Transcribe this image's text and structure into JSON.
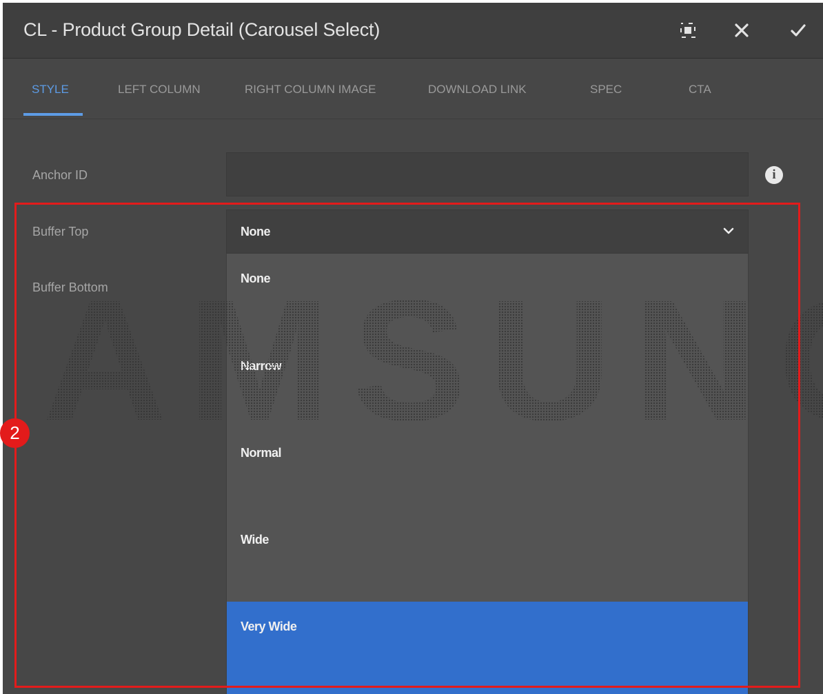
{
  "dialog": {
    "title": "CL - Product Group Detail (Carousel Select)",
    "buttons": {
      "fullscreen": "fullscreen-icon",
      "close": "close-icon",
      "done": "checkmark-icon"
    }
  },
  "tabs": [
    {
      "label": "STYLE",
      "active": true
    },
    {
      "label": "LEFT COLUMN",
      "active": false
    },
    {
      "label": "RIGHT COLUMN IMAGE",
      "active": false
    },
    {
      "label": "DOWNLOAD LINK",
      "active": false
    },
    {
      "label": "SPEC",
      "active": false
    },
    {
      "label": "CTA",
      "active": false
    }
  ],
  "form": {
    "anchor_id": {
      "label": "Anchor ID",
      "value": ""
    },
    "buffer_top": {
      "label": "Buffer Top",
      "value": "None"
    },
    "buffer_bottom": {
      "label": "Buffer Bottom"
    }
  },
  "dropdown": {
    "options": [
      "None",
      "Narrow",
      "Normal",
      "Wide",
      "Very Wide"
    ],
    "highlighted": "Very Wide"
  },
  "watermark": {
    "text": "SAMSUNG",
    "id": "09544469"
  },
  "annotation": {
    "number": "2"
  },
  "colors": {
    "accent": "#5d9ce6",
    "selected": "#326fcc",
    "highlight": "#e31b1b",
    "background": "#474747"
  }
}
